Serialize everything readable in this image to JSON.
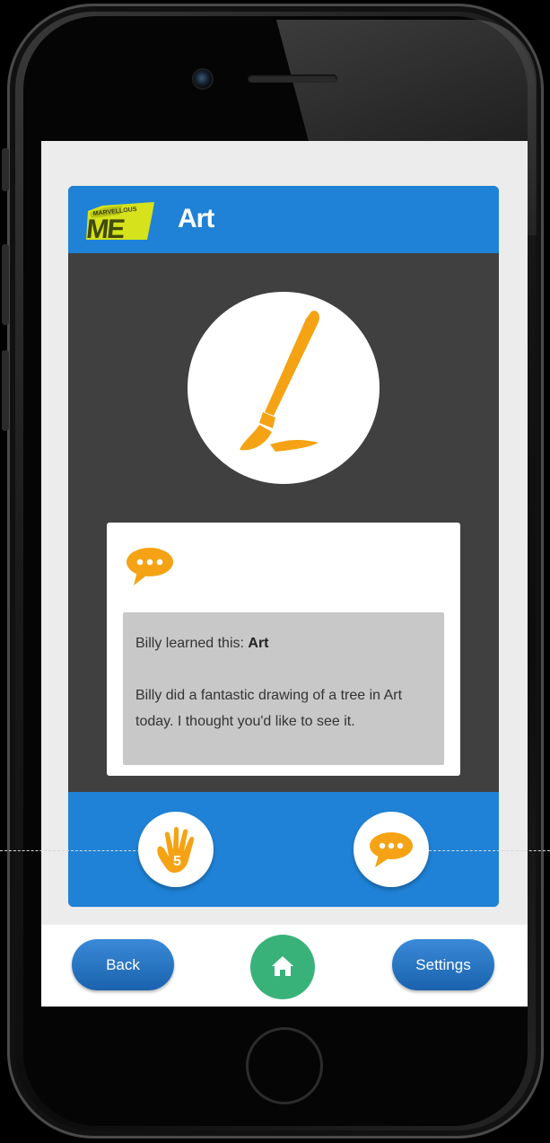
{
  "header": {
    "logo_text": "MARVELLOUS ME",
    "title": "Art"
  },
  "subject": {
    "icon": "paintbrush-icon"
  },
  "message": {
    "icon": "speech-bubble-icon",
    "learned_prefix": "Billy learned this: ",
    "learned_subject": "Art",
    "body": "Billy did a fantastic drawing of a tree in Art today. I thought you'd like to see it."
  },
  "actions": {
    "left_icon": "high-five-hand-icon",
    "right_icon": "speech-bubble-icon"
  },
  "nav": {
    "back_label": "Back",
    "home_icon": "home-icon",
    "settings_label": "Settings"
  },
  "colors": {
    "brand_blue": "#1f82d6",
    "accent_orange": "#f5a315",
    "card_dark": "#404040",
    "home_green": "#39b27a",
    "logo_yellow": "#d6e21b"
  }
}
